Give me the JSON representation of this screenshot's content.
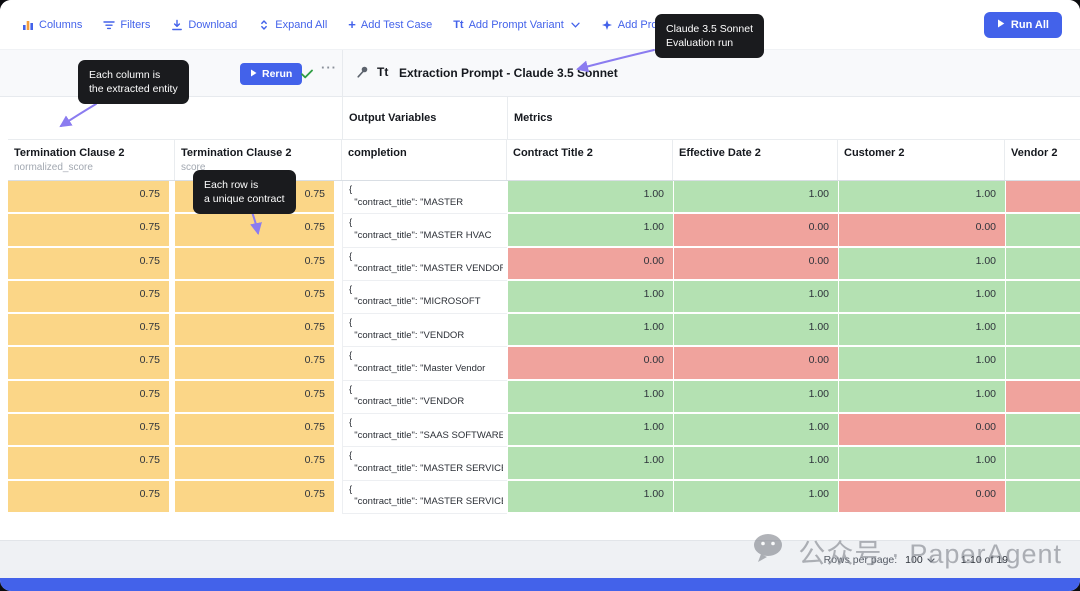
{
  "toolbar": {
    "items": [
      {
        "label": "Columns"
      },
      {
        "label": "Filters"
      },
      {
        "label": "Download"
      },
      {
        "label": "Expand All"
      },
      {
        "label": "Add Test Case"
      },
      {
        "label": "Add Prompt Variant"
      },
      {
        "label": "Add Prompt Deployment"
      }
    ],
    "run_all_label": "Run All"
  },
  "prompt_bar": {
    "rerun_label": "Rerun",
    "title": "Extraction Prompt - Claude 3.5 Sonnet"
  },
  "icons": {
    "plus": "+",
    "tt": "Tt",
    "ellipsis": "···"
  },
  "annotations": {
    "column_tooltip": {
      "line1": "Each column is",
      "line2": "the extracted entity"
    },
    "run_tooltip": {
      "line1": "Claude 3.5 Sonnet",
      "line2": "Evaluation run"
    },
    "row_tooltip": {
      "line1": "Each row is",
      "line2": "a unique contract"
    }
  },
  "table": {
    "group_headers": {
      "output_variables": "Output Variables",
      "metrics": "Metrics"
    },
    "columns": [
      {
        "title": "Termination Clause 2",
        "subtitle": "normalized_score"
      },
      {
        "title": "Termination Clause 2",
        "subtitle": "score"
      },
      {
        "title": "completion",
        "subtitle": ""
      },
      {
        "title": "Contract Title 2",
        "subtitle": ""
      },
      {
        "title": "Effective Date 2",
        "subtitle": ""
      },
      {
        "title": "Customer 2",
        "subtitle": ""
      },
      {
        "title": "Vendor 2",
        "subtitle": ""
      }
    ],
    "rows": [
      {
        "normalized_score": "0.75",
        "score": "0.75",
        "completion_lines": [
          "{",
          "  \"contract_title\": \"MASTER"
        ],
        "metrics": [
          {
            "value": "1.00",
            "status": "pass"
          },
          {
            "value": "1.00",
            "status": "pass"
          },
          {
            "value": "1.00",
            "status": "pass"
          },
          {
            "value": "",
            "status": "fail"
          }
        ]
      },
      {
        "normalized_score": "0.75",
        "score": "0.75",
        "completion_lines": [
          "{",
          "  \"contract_title\": \"MASTER HVAC"
        ],
        "metrics": [
          {
            "value": "1.00",
            "status": "pass"
          },
          {
            "value": "0.00",
            "status": "fail"
          },
          {
            "value": "0.00",
            "status": "fail"
          },
          {
            "value": "",
            "status": "pass"
          }
        ]
      },
      {
        "normalized_score": "0.75",
        "score": "0.75",
        "completion_lines": [
          "{",
          "  \"contract_title\": \"MASTER VENDOR"
        ],
        "metrics": [
          {
            "value": "0.00",
            "status": "fail"
          },
          {
            "value": "0.00",
            "status": "fail"
          },
          {
            "value": "1.00",
            "status": "pass"
          },
          {
            "value": "",
            "status": "pass"
          }
        ]
      },
      {
        "normalized_score": "0.75",
        "score": "0.75",
        "completion_lines": [
          "{",
          "  \"contract_title\": \"MICROSOFT"
        ],
        "metrics": [
          {
            "value": "1.00",
            "status": "pass"
          },
          {
            "value": "1.00",
            "status": "pass"
          },
          {
            "value": "1.00",
            "status": "pass"
          },
          {
            "value": "",
            "status": "pass"
          }
        ]
      },
      {
        "normalized_score": "0.75",
        "score": "0.75",
        "completion_lines": [
          "{",
          "  \"contract_title\": \"VENDOR"
        ],
        "metrics": [
          {
            "value": "1.00",
            "status": "pass"
          },
          {
            "value": "1.00",
            "status": "pass"
          },
          {
            "value": "1.00",
            "status": "pass"
          },
          {
            "value": "",
            "status": "pass"
          }
        ]
      },
      {
        "normalized_score": "0.75",
        "score": "0.75",
        "completion_lines": [
          "{",
          "  \"contract_title\": \"Master Vendor"
        ],
        "metrics": [
          {
            "value": "0.00",
            "status": "fail"
          },
          {
            "value": "0.00",
            "status": "fail"
          },
          {
            "value": "1.00",
            "status": "pass"
          },
          {
            "value": "",
            "status": "pass"
          }
        ]
      },
      {
        "normalized_score": "0.75",
        "score": "0.75",
        "completion_lines": [
          "{",
          "  \"contract_title\": \"VENDOR"
        ],
        "metrics": [
          {
            "value": "1.00",
            "status": "pass"
          },
          {
            "value": "1.00",
            "status": "pass"
          },
          {
            "value": "1.00",
            "status": "pass"
          },
          {
            "value": "",
            "status": "fail"
          }
        ]
      },
      {
        "normalized_score": "0.75",
        "score": "0.75",
        "completion_lines": [
          "{",
          "  \"contract_title\": \"SAAS SOFTWARE"
        ],
        "metrics": [
          {
            "value": "1.00",
            "status": "pass"
          },
          {
            "value": "1.00",
            "status": "pass"
          },
          {
            "value": "0.00",
            "status": "fail"
          },
          {
            "value": "",
            "status": "pass"
          }
        ]
      },
      {
        "normalized_score": "0.75",
        "score": "0.75",
        "completion_lines": [
          "{",
          "  \"contract_title\": \"MASTER SERVICES"
        ],
        "metrics": [
          {
            "value": "1.00",
            "status": "pass"
          },
          {
            "value": "1.00",
            "status": "pass"
          },
          {
            "value": "1.00",
            "status": "pass"
          },
          {
            "value": "",
            "status": "pass"
          }
        ]
      },
      {
        "normalized_score": "0.75",
        "score": "0.75",
        "completion_lines": [
          "{",
          "  \"contract_title\": \"MASTER SERVICES"
        ],
        "metrics": [
          {
            "value": "1.00",
            "status": "pass"
          },
          {
            "value": "1.00",
            "status": "pass"
          },
          {
            "value": "0.00",
            "status": "fail"
          },
          {
            "value": "",
            "status": "pass"
          }
        ]
      }
    ]
  },
  "footer": {
    "rows_per_page_label": "Rows per page:",
    "rows_per_page_value": "100",
    "range_text": "1-10 of 19"
  },
  "watermark": "公众号 · PaperAgent",
  "colors": {
    "accent_blue": "#4362ea",
    "pass_green": "#b4e1b2",
    "fail_red": "#f0a39d",
    "pending_orange": "#fbd687",
    "tooltip_black": "#1a1b1e",
    "arrow_purple": "#8b7cf0"
  }
}
